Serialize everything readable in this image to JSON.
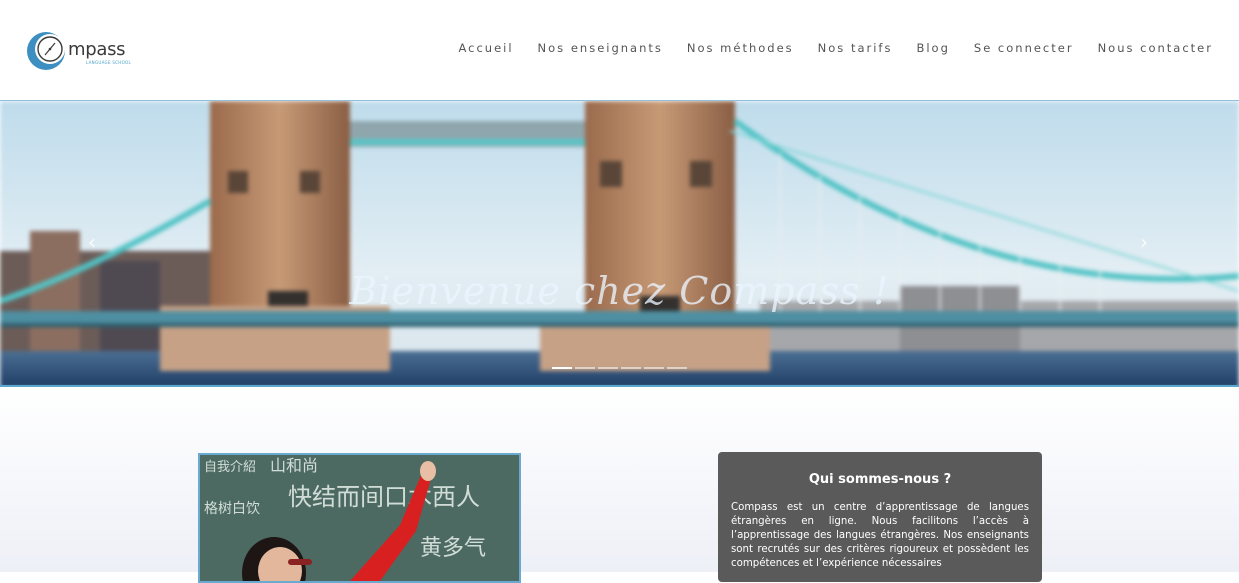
{
  "brand": {
    "logo_text": "mpass",
    "logo_letter": "C",
    "logo_tagline": "LANGUAGE SCHOOL",
    "accent": "#3e8fc1"
  },
  "nav": {
    "items": [
      {
        "label": "Accueil"
      },
      {
        "label": "Nos enseignants"
      },
      {
        "label": "Nos méthodes"
      },
      {
        "label": "Nos tarifs"
      },
      {
        "label": "Blog"
      },
      {
        "label": "Se connecter"
      },
      {
        "label": "Nous contacter"
      }
    ]
  },
  "slider": {
    "caption": "Bienvenue chez Compass !",
    "prev_label": "‹",
    "next_label": "›",
    "slide_count": 6,
    "active_slide": 1,
    "image_icon": "tower-bridge-photo"
  },
  "about": {
    "title": "Qui sommes-nous ?",
    "text": "Compass est un centre d’apprentissage de langues étrangères en ligne. Nous facilitons l’accès à l’apprentissage des langues étrangères. Nos enseignants sont recrutés sur des critères rigoureux et possèdent les compétences et l’expérience nécessaires"
  },
  "teacher_photo": {
    "icon": "teacher-chalkboard-photo",
    "board_chars": [
      "自我介紹",
      "山和尚",
      "快结而间口木西人",
      "格树白饮",
      "黄多气"
    ]
  }
}
